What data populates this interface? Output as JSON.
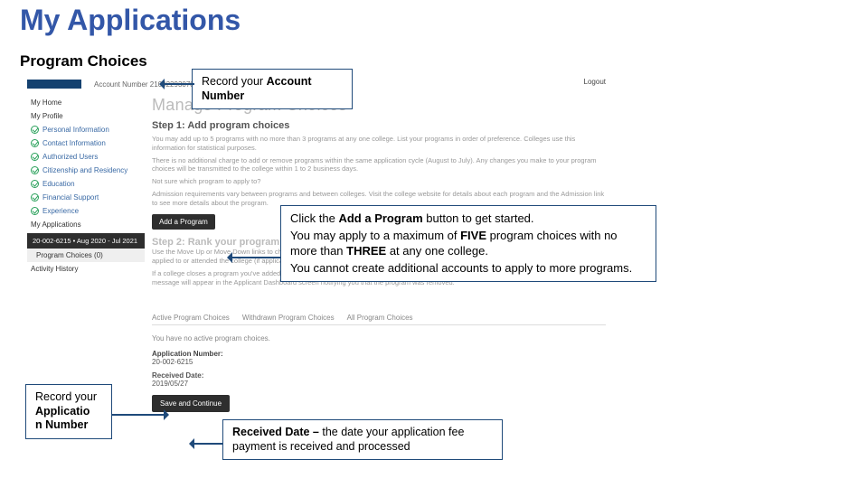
{
  "title": "My Applications",
  "subtitle": "Program Choices",
  "bg": {
    "account_label": "Account Number 210022930782",
    "logout": "Logout",
    "sidebar": {
      "home": "My Home",
      "profile": "My Profile",
      "items": [
        "Personal Information",
        "Contact Information",
        "Authorized Users",
        "Citizenship and Residency",
        "Education",
        "Financial Support",
        "Experience"
      ],
      "my_apps": "My Applications",
      "app_num": "20-002-6215 • Aug 2020 - Jul 2021",
      "prog_choices": "Program Choices (0)",
      "activity": "Activity History"
    },
    "main": {
      "heading": "Manage Program Choices",
      "step1": "Step 1: Add program choices",
      "p1": "You may add up to 5 programs with no more than 3 programs at any one college. List your programs in order of preference. Colleges use this information for statistical purposes.",
      "p2": "There is no additional charge to add or remove programs within the same application cycle (August to July). Any changes you make to your program choices will be transmitted to the college within 1 to 2 business days.",
      "p3": "Not sure which program to apply to?",
      "p4": "Admission requirements vary between programs and between colleges. Visit the college website for details about each program and the Admission link to see more details about the program.",
      "add_btn": "Add a Program",
      "step2": "Step 2: Rank your program choices",
      "p5": "Use the Move Up or Move Down links to change the order of your program choices. A program choice will include all equivalences that you previously applied to or attended the college (if applicable). Use the Delete link to remove a program choice.",
      "p6": "If a college closes a program you've added before you've paid your application fee, the program will be removed from your application automatically. A message will appear in the Applicant Dashboard screen notifying you that the program was removed.",
      "tabs": {
        "active": "Active Program Choices",
        "withdrawn": "Withdrawn Program Choices",
        "all": "All Program Choices"
      },
      "no_active": "You have no active program choices.",
      "app_num_label": "Application Number:",
      "app_num_val": "20-002-6215",
      "recv_label": "Received Date:",
      "recv_val": "2019/05/27",
      "save_btn": "Save and Continue"
    }
  },
  "callouts": {
    "account": {
      "l1": "Record your ",
      "b1": "Account",
      "l2": "Number"
    },
    "main": {
      "l1a": "Click the ",
      "l1b": "Add a Program",
      "l1c": " button to get started.",
      "l2a": "You may apply to a maximum of ",
      "l2b": "FIVE",
      "l2c": " program choices with no  more than ",
      "l2d": "THREE",
      "l2e": " at any one college.",
      "l3": "You cannot create additional accounts to apply to more programs."
    },
    "appnum": {
      "l1": "Record your",
      "l2": "Applicatio",
      "l3": "n  Number"
    },
    "recv": {
      "b": "Received Date – ",
      "t": "the date your application  fee payment is received and processed"
    }
  }
}
